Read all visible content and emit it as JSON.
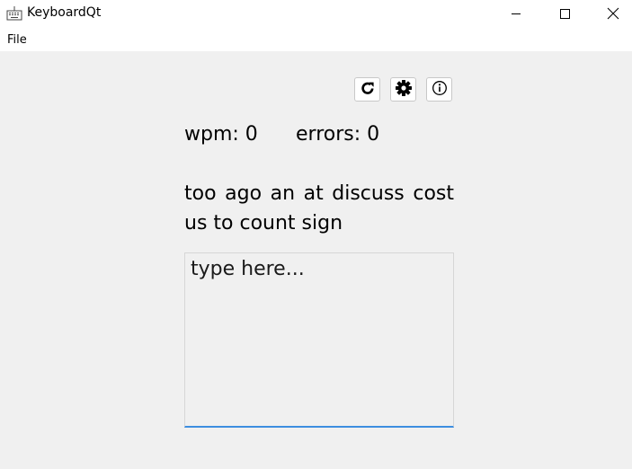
{
  "window": {
    "title": "KeyboardQt",
    "app_icon": "keyboard-icon",
    "controls": {
      "minimize_icon": "minimize-icon",
      "maximize_icon": "maximize-icon",
      "close_icon": "close-icon"
    }
  },
  "menubar": {
    "items": [
      {
        "label": "File"
      }
    ]
  },
  "toolbar": {
    "buttons": [
      {
        "icon": "refresh-icon"
      },
      {
        "icon": "gear-icon"
      },
      {
        "icon": "info-icon"
      }
    ]
  },
  "stats": {
    "wpm": "wpm: 0",
    "errors": "errors: 0"
  },
  "prompt": {
    "text": "too ago an at discuss cost us to count sign"
  },
  "input": {
    "value": "",
    "placeholder": "type here..."
  },
  "colors": {
    "background": "#f0f0f0",
    "titlebar": "#ffffff",
    "focus_accent": "#3d8ee0"
  }
}
